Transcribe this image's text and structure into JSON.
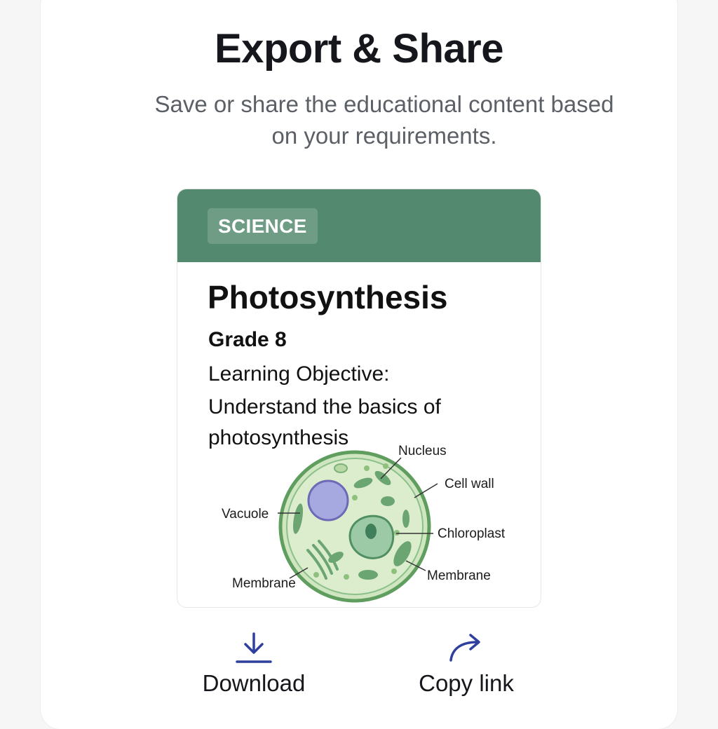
{
  "header": {
    "title": "Export & Share",
    "subtitle": "Save or share the educational content based on your requirements."
  },
  "card": {
    "subject_tag": "SCIENCE",
    "topic": "Photosynthesis",
    "grade": "Grade 8",
    "objective_label": "Learning Objective:",
    "objective_text": "Understand the basics of photosynthesis",
    "accent_color": "#53896e",
    "diagram_labels": {
      "nucleus": "Nucleus",
      "cell_wall": "Cell wall",
      "vacuole": "Vacuole",
      "chloroplast": "Chloroplast",
      "membrane_left": "Membrane",
      "membrane_right": "Membrane"
    }
  },
  "actions": {
    "download": {
      "label": "Download",
      "icon": "download-icon"
    },
    "copy_link": {
      "label": "Copy link",
      "icon": "share-arrow-icon"
    },
    "icon_color": "#2f3f9e"
  }
}
